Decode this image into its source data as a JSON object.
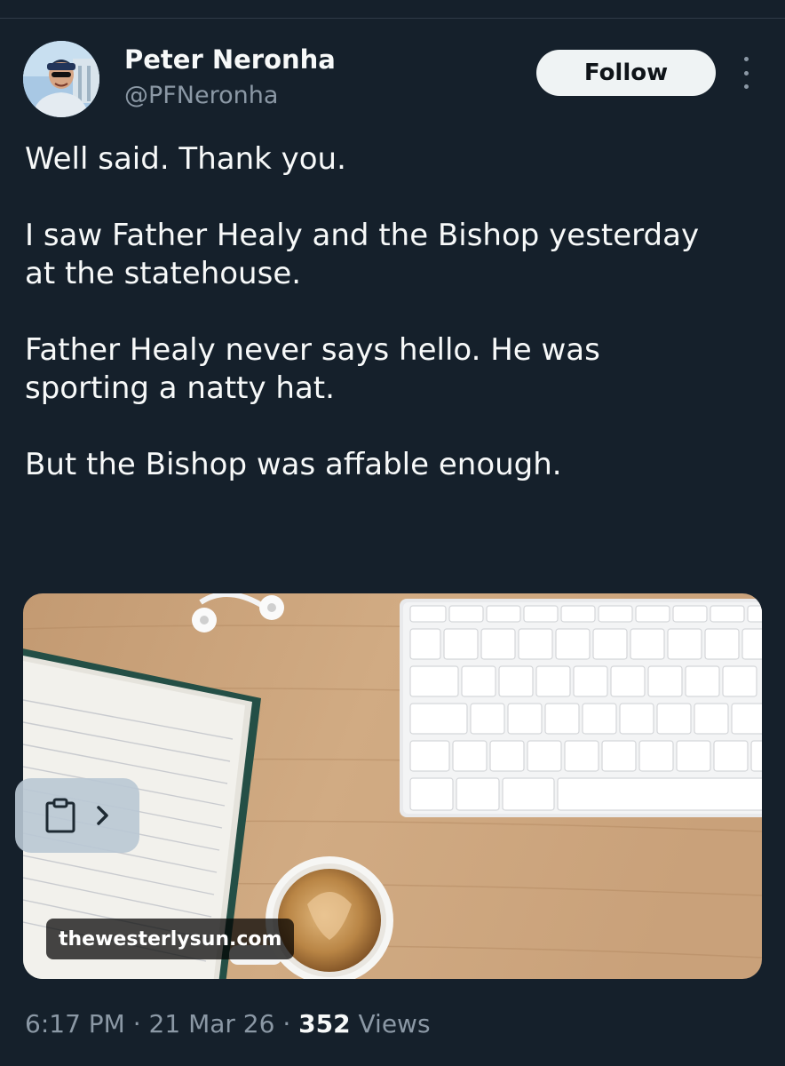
{
  "author": {
    "name": "Peter Neronha",
    "handle": "@PFNeronha",
    "avatar_icon": "profile-photo"
  },
  "actions": {
    "follow_label": "Follow",
    "more_icon": "vertical-ellipsis-icon"
  },
  "tweet": {
    "paragraphs": [
      [
        "Well said.  Thank you."
      ],
      [
        "I saw Father Healy and the Bishop yesterday",
        "at the statehouse."
      ],
      [
        "Father Healy never says hello. He was",
        "sporting a natty hat."
      ],
      [
        "But the Bishop was affable enough."
      ]
    ]
  },
  "link_card": {
    "domain": "thewesterlysun.com",
    "clip_icon": "clipboard-icon",
    "chevron_icon": "chevron-right-icon"
  },
  "meta": {
    "time": "6:17 PM",
    "separator": "·",
    "date": "21 Mar 26",
    "views_count": "352",
    "views_label": "Views"
  },
  "colors": {
    "background": "#15202b",
    "text_primary": "#f7f9f9",
    "text_secondary": "#8b98a5",
    "follow_bg": "#eff3f4"
  }
}
